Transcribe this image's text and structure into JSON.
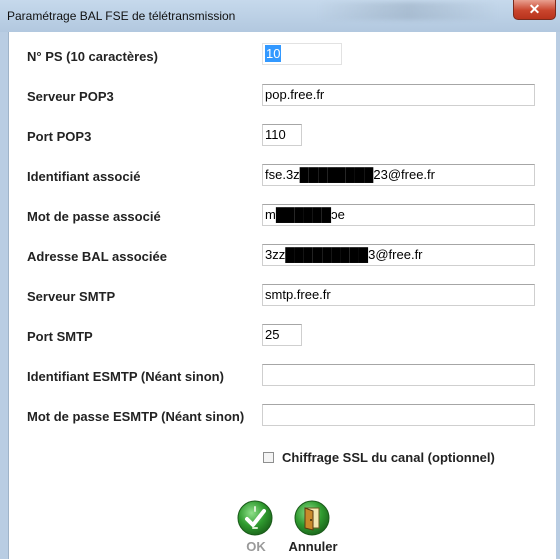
{
  "window": {
    "title": "Paramétrage BAL FSE de télétransmission",
    "close_symbol": "✕"
  },
  "fields": [
    {
      "label": "N° PS (10 caractères)",
      "value": "10"
    },
    {
      "label": "Serveur POP3",
      "value": "pop.free.fr"
    },
    {
      "label": "Port POP3",
      "value": "110"
    },
    {
      "label": "Identifiant associé",
      "value": "fse.3z████████23@free.fr"
    },
    {
      "label": "Mot de passe associé",
      "value": "m██████ɔe"
    },
    {
      "label": "Adresse BAL associée",
      "value": "3zz█████████3@free.fr"
    },
    {
      "label": "Serveur SMTP",
      "value": "smtp.free.fr"
    },
    {
      "label": "Port SMTP",
      "value": "25"
    },
    {
      "label": "Identifiant ESMTP  (Néant sinon)",
      "value": ""
    },
    {
      "label": "Mot de passe ESMTP  (Néant sinon)",
      "value": ""
    }
  ],
  "ssl_option": {
    "label": "Chiffrage SSL du canal (optionnel)",
    "checked": false
  },
  "buttons": {
    "ok": {
      "label": "OK",
      "icon": "ok-check-icon",
      "enabled": false
    },
    "cancel": {
      "label": "Annuler",
      "icon": "exit-door-icon",
      "enabled": true
    }
  },
  "colors": {
    "window_frame": "#b9cde3",
    "close_button": "#c9452d",
    "selection": "#3399ff",
    "icon_green": "#2f9a2f",
    "disabled_text": "#9a9a9a"
  }
}
